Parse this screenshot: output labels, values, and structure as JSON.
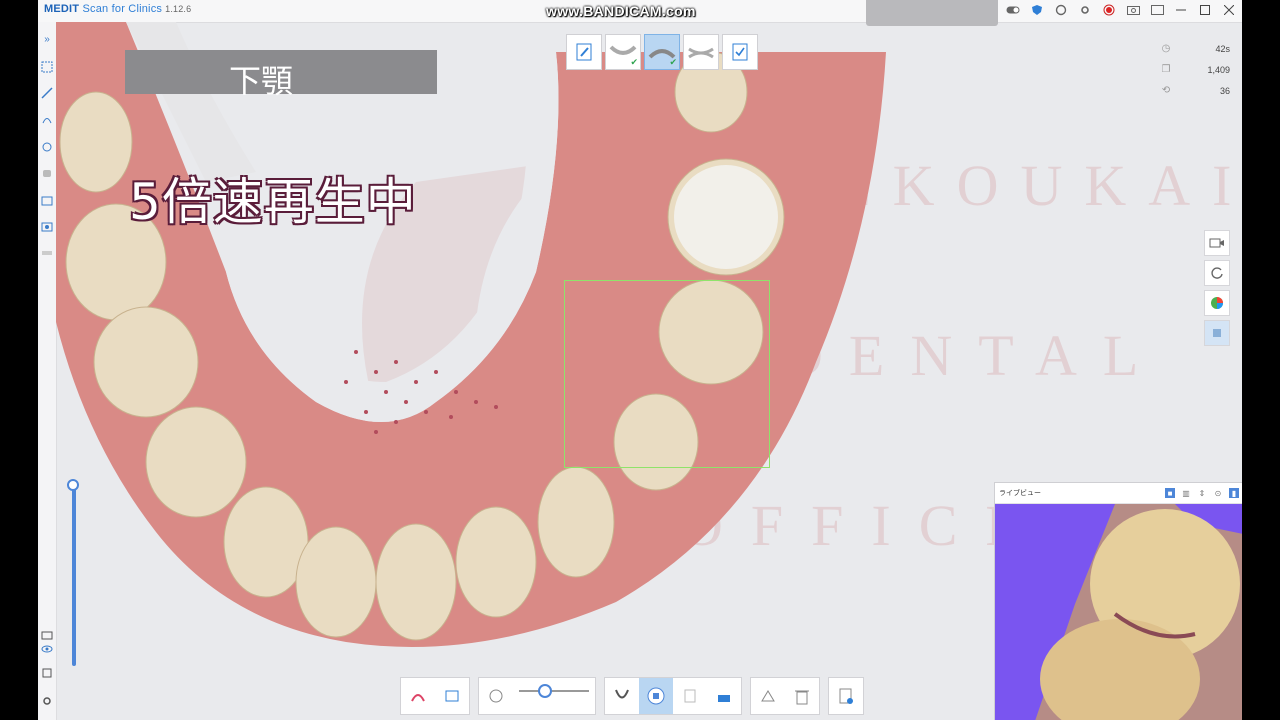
{
  "app": {
    "brand_prefix": "MEDIT",
    "brand_rest": " Scan for Clinics",
    "version": "1.12.6"
  },
  "recording_watermark": "www.BANDICAM.com",
  "overlay": {
    "jaw_label": "下顎",
    "speed_label": "5倍速再生中"
  },
  "logo_watermark": {
    "line1": "SEKOUKAI",
    "line2": "DENTAL",
    "line3": "OFFICE"
  },
  "stats": {
    "time": "42s",
    "frames": "1,409",
    "count": "36"
  },
  "stage_tabs": [
    {
      "name": "Note",
      "icon": "note-edit-icon"
    },
    {
      "name": "Upper",
      "icon": "upper-jaw-icon",
      "done": true
    },
    {
      "name": "Lower",
      "icon": "lower-jaw-icon",
      "done": true,
      "active": true
    },
    {
      "name": "Occlusion",
      "icon": "occlusion-icon"
    },
    {
      "name": "Review",
      "icon": "review-check-icon"
    }
  ],
  "live_view": {
    "title": "ライブビュー"
  },
  "colors": {
    "accent": "#4d86d8",
    "focus": "#8fe36a",
    "gum": "#d98a86",
    "tooth": "#e9dcc2"
  }
}
